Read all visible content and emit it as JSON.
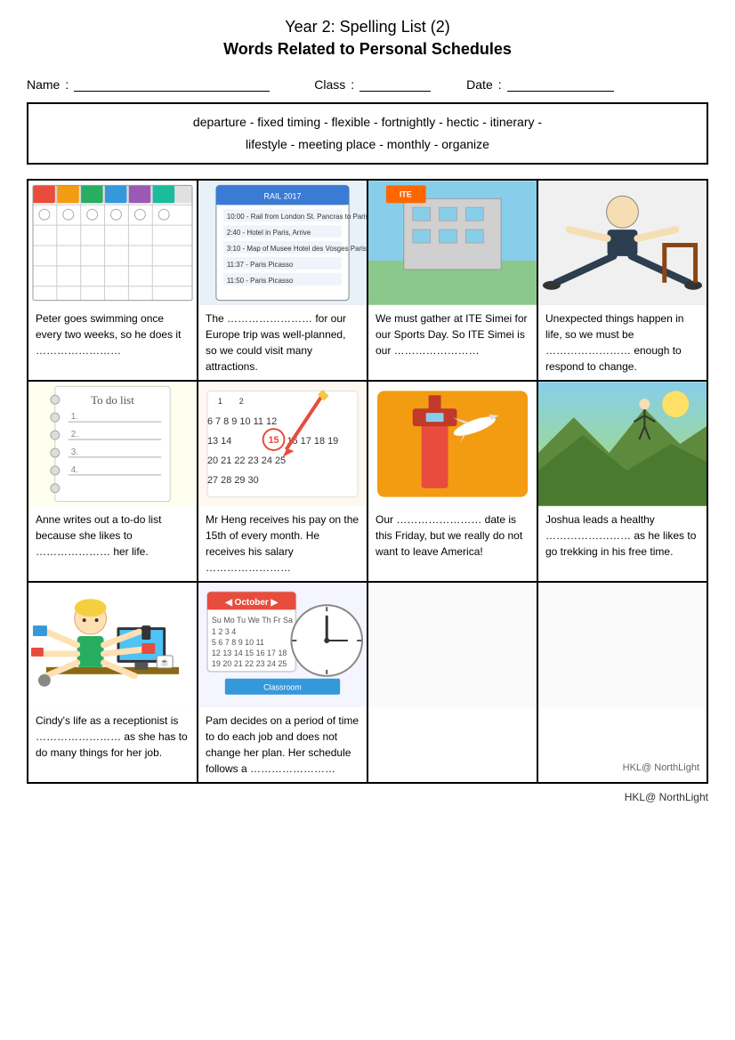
{
  "title": "Year 2: Spelling List (2)",
  "subtitle": "Words Related to Personal Schedules",
  "fields": {
    "name_label": "Name",
    "name_colon": ":",
    "class_label": "Class",
    "class_colon": ":",
    "date_label": "Date",
    "date_colon": ":"
  },
  "wordbox": {
    "line1": "departure   -   fixed timing   -   flexible   -   fortnightly   -   hectic   -   itinerary   -",
    "line2": "lifestyle   -   meeting place   -   monthly   -   organize"
  },
  "cells": [
    {
      "id": "cell-1",
      "image_label": "calendar-image",
      "text": "Peter goes swimming once every two weeks, so he does it ……………………"
    },
    {
      "id": "cell-2",
      "image_label": "itinerary-image",
      "text": "The …………………… for our Europe trip was well-planned, so we could visit many attractions."
    },
    {
      "id": "cell-3",
      "image_label": "building-image",
      "text": "We must gather at ITE Simei for our Sports Day. So ITE Simei is our ……………………"
    },
    {
      "id": "cell-4",
      "image_label": "flexible-image",
      "text": "Unexpected things happen in life, so we must be …………………… enough to respond to change."
    },
    {
      "id": "cell-5",
      "image_label": "todo-image",
      "text": "Anne writes out a to-do list because she likes to ………………… her life."
    },
    {
      "id": "cell-6",
      "image_label": "monthly-calendar-image",
      "text": "Mr Heng receives his pay on the 15th of every month. He receives his salary ……………………"
    },
    {
      "id": "cell-7",
      "image_label": "departure-image",
      "text": "Our …………………… date is this Friday, but we really do not want to leave America!"
    },
    {
      "id": "cell-8",
      "image_label": "lifestyle-image",
      "text": "Joshua leads a healthy …………………… as he likes to go trekking in his free time."
    },
    {
      "id": "cell-9",
      "image_label": "hectic-image",
      "text": "Cindy's life as a receptionist is …………………… as she has to do many things for her job."
    },
    {
      "id": "cell-10",
      "image_label": "fixed-timing-image",
      "text": "Pam decides on a period of time to do each job and does not change her plan. Her schedule follows a ……………………"
    }
  ],
  "footer": "HKL@ NorthLight"
}
